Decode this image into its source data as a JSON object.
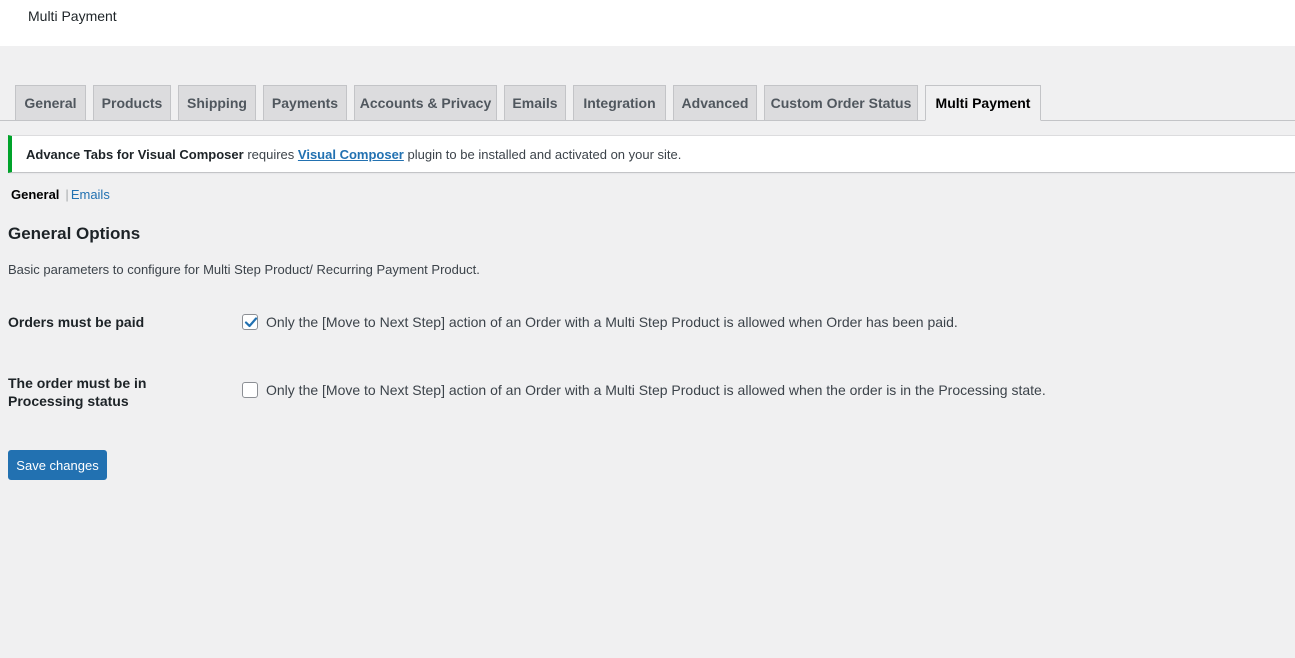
{
  "header": {
    "title": "Multi Payment"
  },
  "tabs": [
    {
      "label": "General"
    },
    {
      "label": "Products"
    },
    {
      "label": "Shipping"
    },
    {
      "label": "Payments"
    },
    {
      "label": "Accounts & Privacy"
    },
    {
      "label": "Emails"
    },
    {
      "label": "Integration"
    },
    {
      "label": "Advanced"
    },
    {
      "label": "Custom Order Status"
    },
    {
      "label": "Multi Payment",
      "active": true
    }
  ],
  "notice": {
    "strong": "Advance Tabs for Visual Composer",
    "text_before": " requires ",
    "link": "Visual Composer",
    "text_after": " plugin to be installed and activated on your site.",
    "accent_color": "#00a32a"
  },
  "subnav": {
    "current": "General",
    "separator": "|",
    "link": "Emails"
  },
  "section": {
    "title": "General Options",
    "description": "Basic parameters to configure for Multi Step Product/ Recurring Payment Product."
  },
  "options": [
    {
      "label": "Orders must be paid",
      "checked": true,
      "text": "Only the [Move to Next Step] action of an Order with a Multi Step Product is allowed when Order has been paid."
    },
    {
      "label_line1": "The order must be in",
      "label_line2": "Processing status",
      "checked": false,
      "text": "Only the [Move to Next Step] action of an Order with a Multi Step Product is allowed when the order is in the Processing state."
    }
  ],
  "save_button": {
    "label": "Save changes",
    "color": "#2271b1"
  },
  "icons": {
    "checkmark": "checkmark-icon"
  }
}
